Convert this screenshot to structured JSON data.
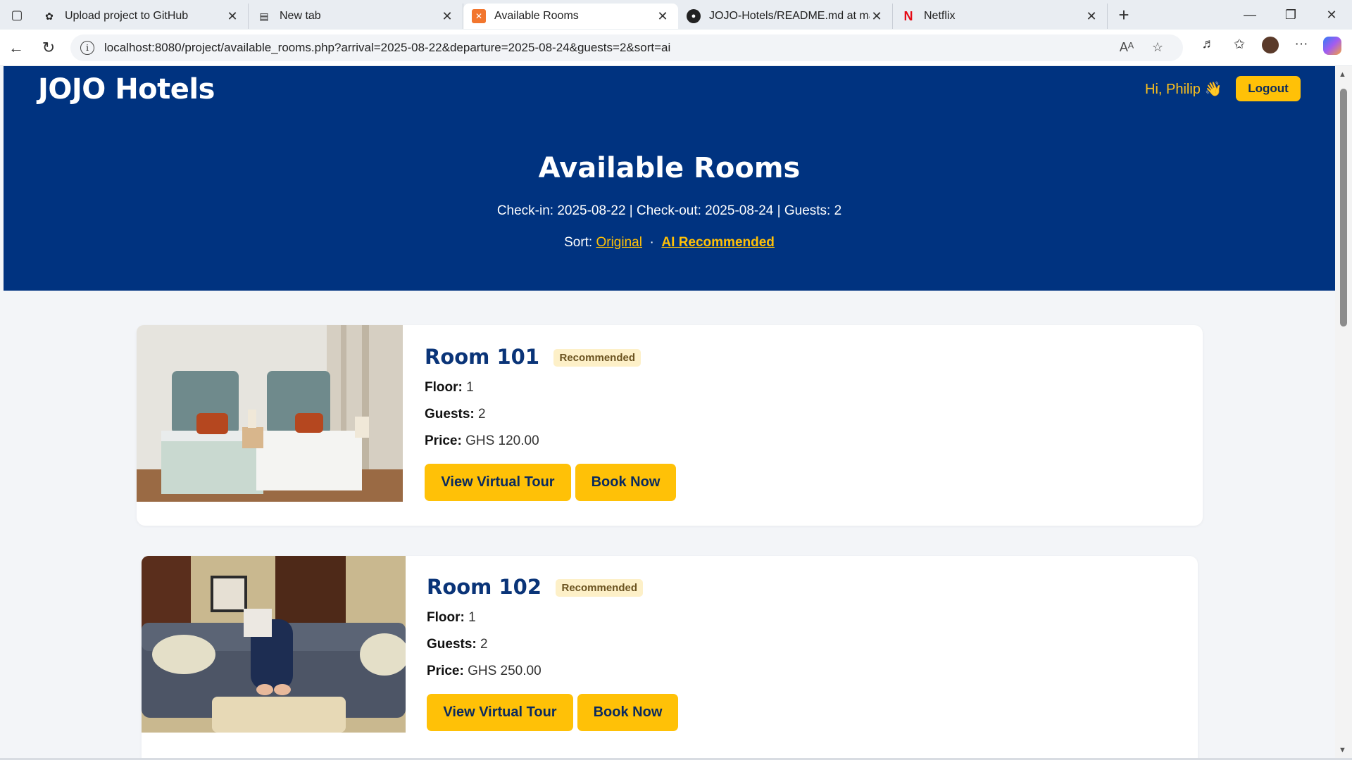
{
  "browser": {
    "tabs": [
      {
        "title": "Upload project to GitHub",
        "icon": "openai-icon",
        "active": false
      },
      {
        "title": "New tab",
        "icon": "newtab-icon",
        "active": false
      },
      {
        "title": "Available Rooms",
        "icon": "xampp-icon",
        "active": true
      },
      {
        "title": "JOJO-Hotels/README.md at main",
        "icon": "github-icon",
        "active": false
      },
      {
        "title": "Netflix",
        "icon": "netflix-icon",
        "active": false
      }
    ],
    "url": "localhost:8080/project/available_rooms.php?arrival=2025-08-22&departure=2025-08-24&guests=2&sort=ai"
  },
  "header": {
    "brand": "JOJO Hotels",
    "greeting": "Hi, Philip 👋",
    "logout_label": "Logout"
  },
  "hero": {
    "title": "Available Rooms",
    "stay_info": "Check-in: 2025-08-22 | Check-out: 2025-08-24 | Guests: 2",
    "sort_label": "Sort:",
    "sort_original": "Original",
    "sort_separator": "·",
    "sort_ai": "AI Recommended"
  },
  "labels": {
    "floor": "Floor:",
    "guests": "Guests:",
    "price": "Price:",
    "tour_button": "View Virtual Tour",
    "book_button": "Book Now"
  },
  "rooms": [
    {
      "name": "Room 101",
      "badge": "Recommended",
      "floor": "1",
      "guests": "2",
      "price": "GHS 120.00"
    },
    {
      "name": "Room 102",
      "badge": "Recommended",
      "floor": "1",
      "guests": "2",
      "price": "GHS 250.00"
    }
  ],
  "colors": {
    "hero_bg": "#003380",
    "accent": "#ffc107",
    "room_title": "#0a3478"
  }
}
